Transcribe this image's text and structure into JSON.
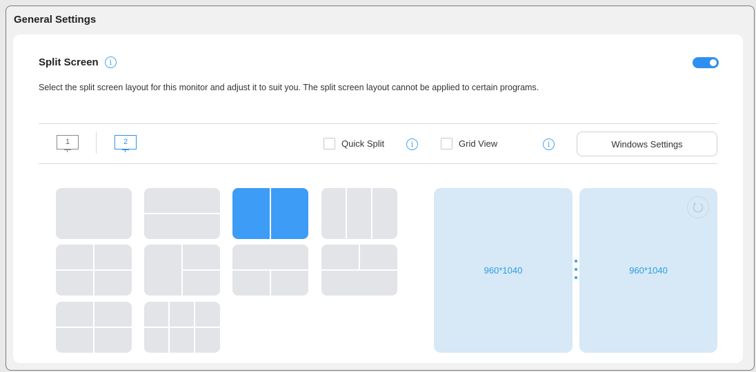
{
  "window": {
    "title": "General Settings"
  },
  "split_screen": {
    "title": "Split Screen",
    "enabled": true,
    "description": "Select the split screen layout for this monitor and adjust it to suit you. The split screen layout cannot be applied to certain programs."
  },
  "monitors": [
    {
      "label": "1",
      "selected": false
    },
    {
      "label": "2",
      "selected": true
    }
  ],
  "options": {
    "quick_split": {
      "label": "Quick Split",
      "checked": false
    },
    "grid_view": {
      "label": "Grid View",
      "checked": false
    },
    "windows_settings_label": "Windows Settings"
  },
  "layouts": [
    {
      "id": "full",
      "selected": false
    },
    {
      "id": "top-bottom",
      "selected": false
    },
    {
      "id": "left-right",
      "selected": true
    },
    {
      "id": "three-columns",
      "selected": false
    },
    {
      "id": "four-grid-offset",
      "selected": false
    },
    {
      "id": "left-with-right-split",
      "selected": false
    },
    {
      "id": "top-with-bottom-split",
      "selected": false
    },
    {
      "id": "bottom-with-top-split",
      "selected": false
    },
    {
      "id": "four-grid",
      "selected": false
    },
    {
      "id": "six-grid",
      "selected": false
    }
  ],
  "preview": {
    "left_size": "960*1040",
    "right_size": "960*1040"
  },
  "colors": {
    "accent": "#2f8ff0",
    "selected_layout": "#3d9cf5",
    "preview_bg": "#d7e8f7",
    "preview_text": "#2aa0e0"
  }
}
